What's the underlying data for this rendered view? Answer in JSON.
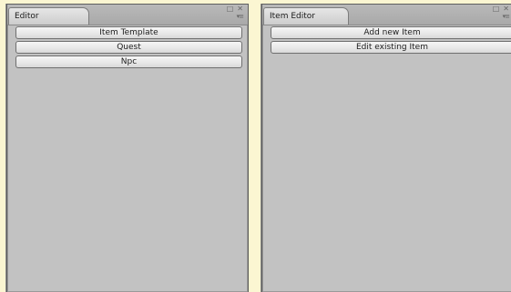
{
  "left_panel": {
    "tab_label": "Editor",
    "buttons": [
      "Item Template",
      "Quest",
      "Npc"
    ]
  },
  "right_panel": {
    "tab_label": "Item Editor",
    "buttons": [
      "Add new Item",
      "Edit existing Item"
    ]
  },
  "icons": {
    "maximize": "maximize-icon",
    "close": "close-icon",
    "menu": "context-menu-icon"
  },
  "colors": {
    "desktop_background": "#fbf6d2",
    "panel_background": "#c2c2c2"
  }
}
